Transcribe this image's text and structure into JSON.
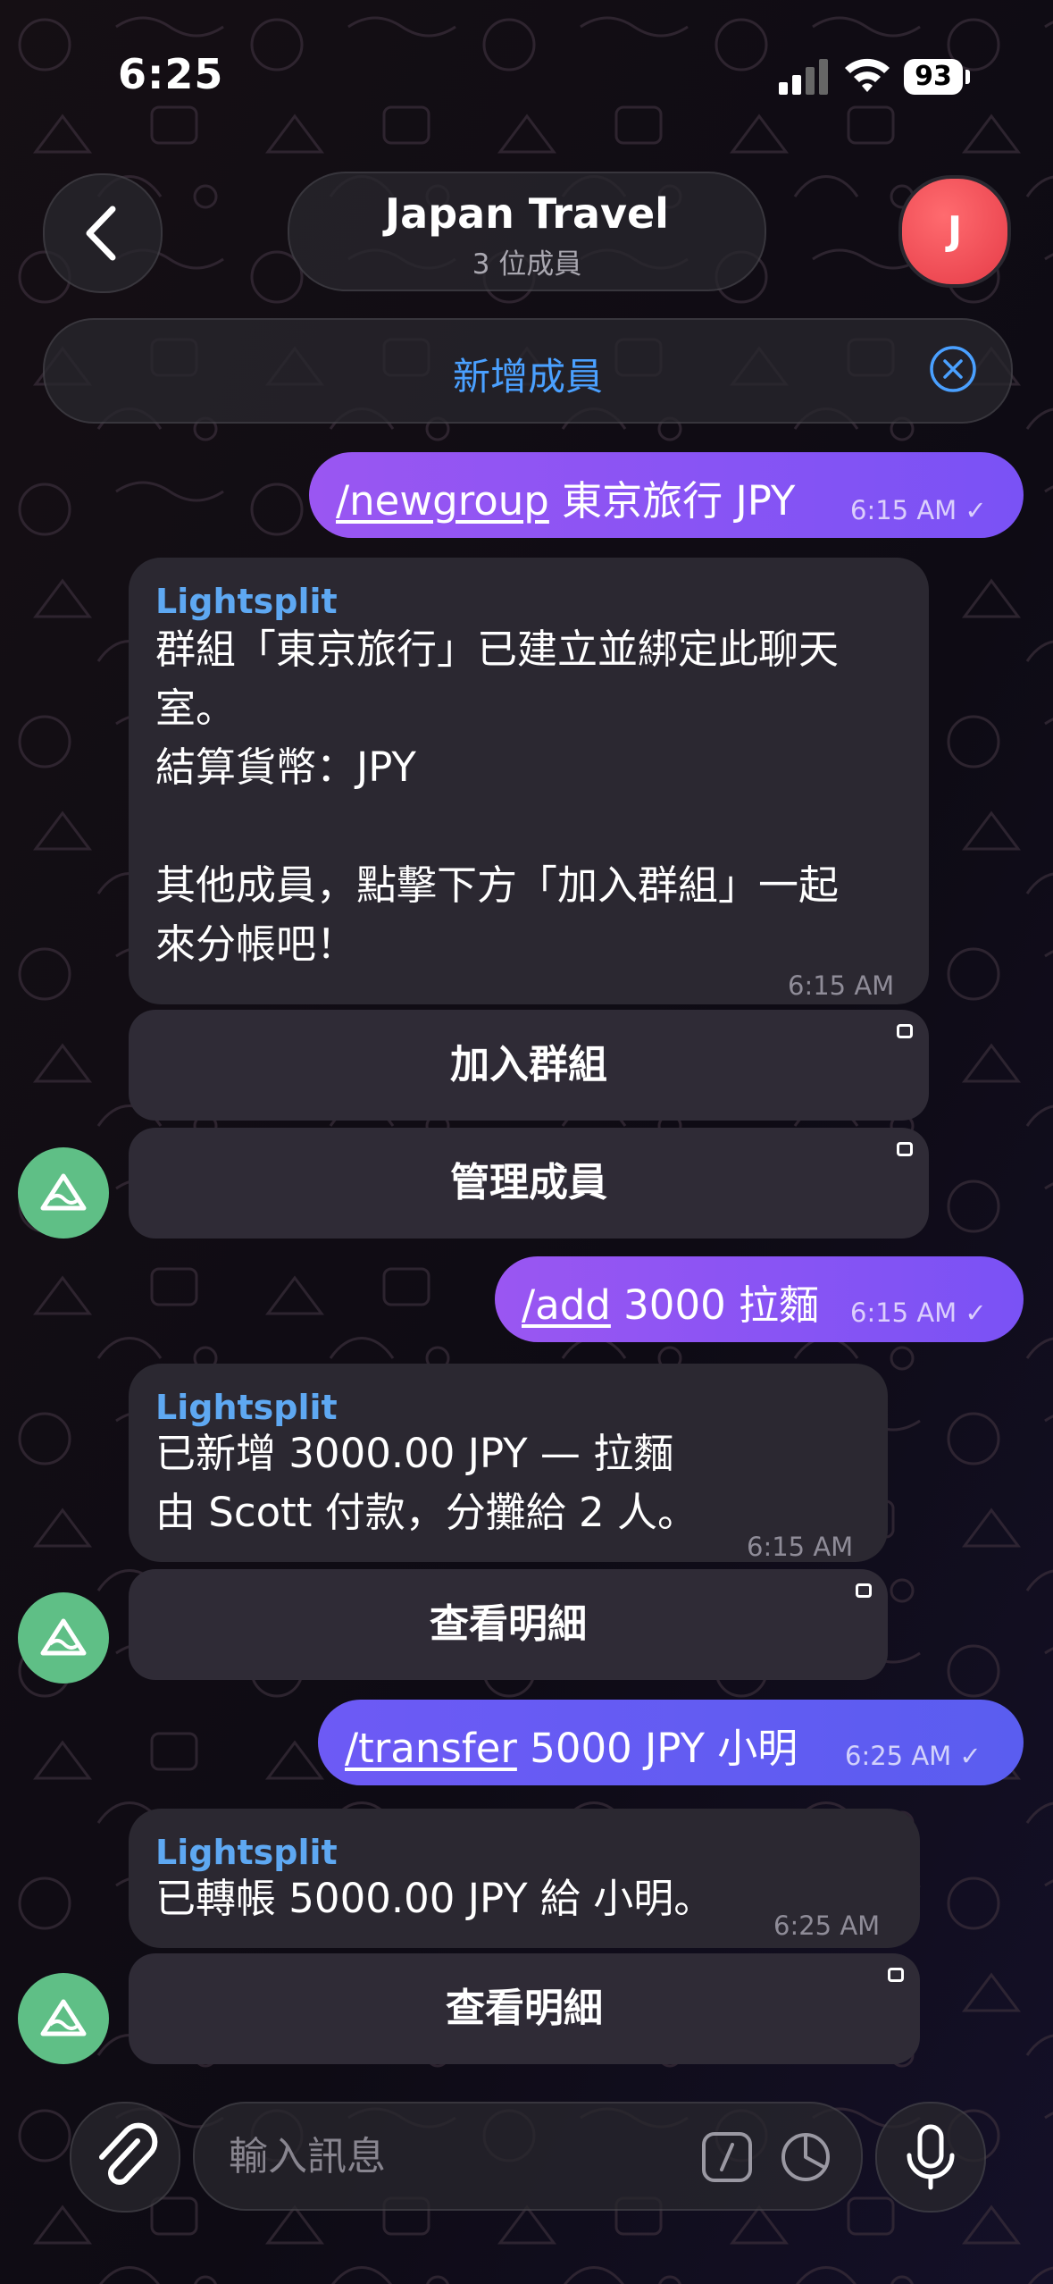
{
  "status_bar": {
    "time": "6:25",
    "battery": "93"
  },
  "header": {
    "title": "Japan Travel",
    "subtitle": "3 位成員",
    "avatar_letter": "J"
  },
  "banner": {
    "label": "新增成員"
  },
  "messages": [
    {
      "cmd": "/newgroup",
      "text": " 東京旅行 JPY",
      "time": "6:15 AM"
    },
    {
      "sender": "Lightsplit",
      "lines": [
        "群組「東京旅行」已建立並綁定此聊天",
        "室。",
        "結算貨幣：JPY",
        "",
        "其他成員，點擊下方「加入群組」一起",
        "來分帳吧！"
      ],
      "time": "6:15 AM",
      "buttons": [
        "加入群組",
        "管理成員"
      ]
    },
    {
      "cmd": "/add",
      "text": " 3000 拉麵",
      "time": "6:15 AM"
    },
    {
      "sender": "Lightsplit",
      "lines": [
        "已新增 3000.00 JPY — 拉麵",
        "由 Scott 付款，分攤給 2 人。"
      ],
      "time": "6:15 AM",
      "buttons": [
        "查看明細"
      ]
    },
    {
      "cmd": "/transfer",
      "text": " 5000 JPY 小明",
      "time": "6:25 AM"
    },
    {
      "sender": "Lightsplit",
      "lines": [
        "已轉帳 5000.00 JPY 給 小明。"
      ],
      "time": "6:25 AM",
      "buttons": [
        "查看明細"
      ]
    }
  ],
  "composer": {
    "placeholder": "輸入訊息"
  }
}
